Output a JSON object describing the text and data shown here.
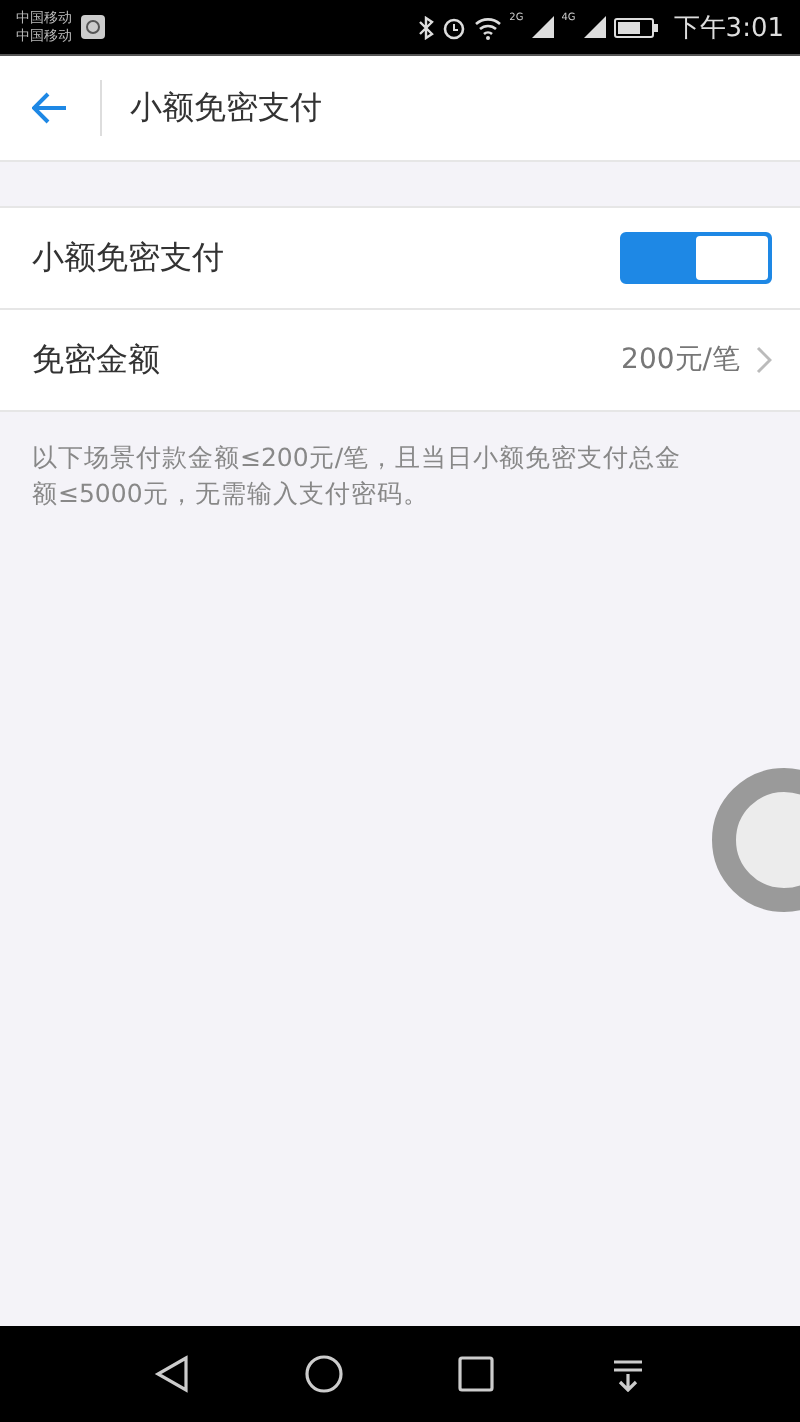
{
  "status_bar": {
    "carriers": [
      "中国移动",
      "中国移动"
    ],
    "time": "下午3:01",
    "signal_labels": [
      "2G",
      "4G"
    ]
  },
  "header": {
    "title": "小额免密支付"
  },
  "settings": [
    {
      "kind": "toggle",
      "label": "小额免密支付",
      "on": true
    },
    {
      "kind": "link",
      "label": "免密金额",
      "value": "200元/笔"
    }
  ],
  "note": "以下场景付款金额≤200元/笔，且当日小额免密支付总金额≤5000元，无需输入支付密码。"
}
